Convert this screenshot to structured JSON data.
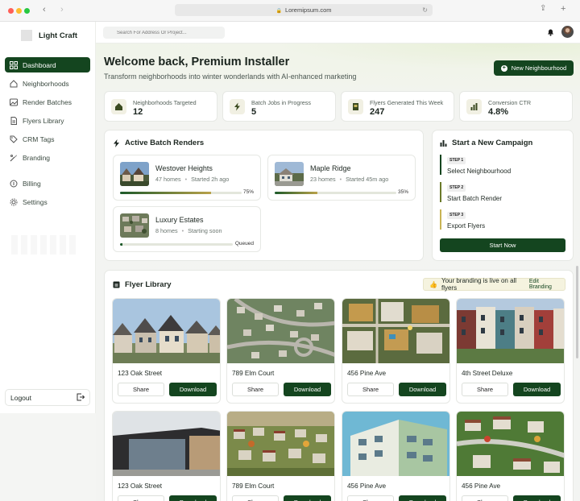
{
  "browser": {
    "url": "Loremipsum.com"
  },
  "app": {
    "brand": "Light Craft"
  },
  "sidebar": {
    "items": [
      {
        "label": "Dashboard",
        "icon": "dashboard-icon",
        "active": true
      },
      {
        "label": "Neighborhoods",
        "icon": "home-icon"
      },
      {
        "label": "Render Batches",
        "icon": "image-icon"
      },
      {
        "label": "Flyers Library",
        "icon": "document-icon"
      },
      {
        "label": "CRM Tags",
        "icon": "tag-icon"
      },
      {
        "label": "Branding",
        "icon": "palette-icon"
      }
    ],
    "secondary": [
      {
        "label": "Billing",
        "icon": "card-icon"
      },
      {
        "label": "Settings",
        "icon": "gear-icon"
      }
    ],
    "logout": "Logout"
  },
  "topbar": {
    "search_placeholder": "Search For Address Or Project..."
  },
  "header": {
    "title": "Welcome back, Premium Installer",
    "subtitle": "Transform neighborhoods into winter wonderlands with AI-enhanced marketing",
    "new_button": "New Neighbourhood"
  },
  "stats": [
    {
      "label": "Neighborhoods Targeted",
      "value": "12"
    },
    {
      "label": "Batch Jobs in Progress",
      "value": "5"
    },
    {
      "label": "Flyers Generated This Week",
      "value": "247"
    },
    {
      "label": "Conversion CTR",
      "value": "4.8%"
    }
  ],
  "batch": {
    "title": "Active Batch Renders",
    "items": [
      {
        "name": "Westover Heights",
        "homes": "47 homes",
        "status": "Started 2h ago",
        "progress": 75,
        "progress_label": "75%"
      },
      {
        "name": "Maple Ridge",
        "homes": "23 homes",
        "status": "Started 45m ago",
        "progress": 35,
        "progress_label": "35%"
      },
      {
        "name": "Luxury Estates",
        "homes": "8 homes",
        "status": "Starting soon",
        "progress": 2,
        "progress_label": "Queued"
      }
    ]
  },
  "campaign": {
    "title": "Start a New Campaign",
    "steps": [
      {
        "badge": "STEP 1",
        "label": "Select Neighbourhood",
        "color": "#14451f"
      },
      {
        "badge": "STEP 2",
        "label": "Start Batch Render",
        "color": "#6b7a2a"
      },
      {
        "badge": "STEP 3",
        "label": "Export Flyers",
        "color": "#c8b454"
      }
    ],
    "button": "Start Now"
  },
  "library": {
    "title": "Flyer Library",
    "notice": "Your branding is live on all flyers",
    "edit": "Edit Branding",
    "share": "Share",
    "download": "Download",
    "flyers": [
      {
        "name": "123 Oak Street"
      },
      {
        "name": "789 Elm Court"
      },
      {
        "name": "456 Pine Ave"
      },
      {
        "name": "4th Street Deluxe"
      },
      {
        "name": "123 Oak Street"
      },
      {
        "name": "789 Elm Court"
      },
      {
        "name": "456 Pine Ave"
      },
      {
        "name": "456 Pine Ave"
      }
    ]
  },
  "colors": {
    "accent": "#14451f",
    "highlight": "#b9a24a"
  }
}
